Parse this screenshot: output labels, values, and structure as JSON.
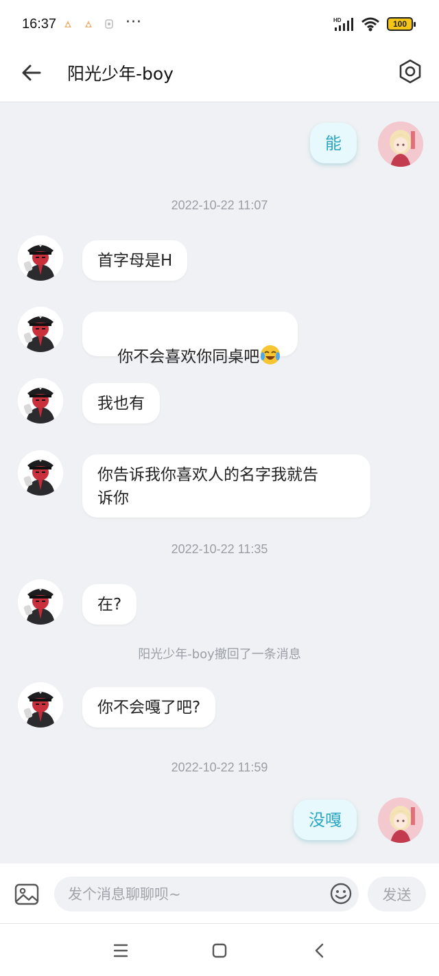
{
  "status_bar": {
    "time": "16:37",
    "dots": "···",
    "network": "HD",
    "battery": "100"
  },
  "header": {
    "title": "阳光少年-boy"
  },
  "messages": [
    {
      "side": "right",
      "text": "能"
    },
    {
      "type": "time",
      "text": "2022-10-22 11:07"
    },
    {
      "side": "left",
      "text": "首字母是H"
    },
    {
      "side": "left",
      "text": "你不会喜欢你同桌吧"
    },
    {
      "side": "left",
      "text": "我也有"
    },
    {
      "side": "left",
      "text": "你告诉我你喜欢人的名字我就告\n诉你"
    },
    {
      "type": "time",
      "text": "2022-10-22 11:35"
    },
    {
      "side": "left",
      "text": "在?"
    },
    {
      "type": "system",
      "text": "阳光少年-boy撤回了一条消息"
    },
    {
      "side": "left",
      "text": "你不会嘎了吧?"
    },
    {
      "type": "time",
      "text": "2022-10-22 11:59"
    },
    {
      "side": "right",
      "text": "没嘎"
    }
  ],
  "input_bar": {
    "placeholder": "发个消息聊聊呗~",
    "send_label": "发送"
  },
  "colors": {
    "accent_text": "#2ca6c2",
    "right_bubble_bg": "#e7f9fd",
    "chat_bg": "#eff1f4"
  }
}
